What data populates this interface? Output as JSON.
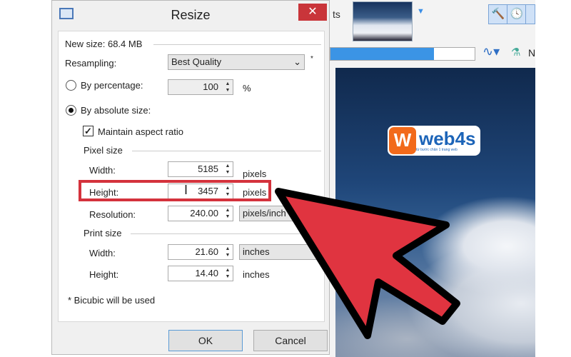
{
  "background_app": {
    "tab_partial": "ts",
    "progress_percent": 72,
    "toolbar_partial_text": "N",
    "icons": [
      "hammer-icon",
      "clock-icon",
      "path-icon",
      "flask-icon"
    ]
  },
  "logo": {
    "text": "web4s",
    "tagline": "từ bước chân 1 trang web",
    "letter": "W"
  },
  "dialog": {
    "title": "Resize",
    "close": "✕",
    "new_size": "New size: 68.4 MB",
    "resampling_label": "Resampling:",
    "resampling_value": "Best Quality",
    "resampling_note": "*",
    "by_percentage": "By percentage:",
    "percentage_value": "100",
    "percent_unit": "%",
    "by_absolute": "By absolute size:",
    "maintain_aspect": "Maintain aspect ratio",
    "pixel_size": "Pixel size",
    "px_width_label": "Width:",
    "px_width_value": "5185",
    "px_width_unit": "pixels",
    "px_height_label": "Height:",
    "px_height_value": "3457",
    "px_height_unit": "pixels",
    "resolution_label": "Resolution:",
    "resolution_value": "240.00",
    "resolution_unit": "pixels/inch",
    "print_size": "Print size",
    "pr_width_label": "Width:",
    "pr_width_value": "21.60",
    "pr_width_unit": "inches",
    "pr_height_label": "Height:",
    "pr_height_value": "14.40",
    "pr_height_unit": "inches",
    "footnote": "* Bicubic will be used",
    "ok": "OK",
    "cancel": "Cancel"
  },
  "colors": {
    "highlight": "#d4323c",
    "arrow": "#e03440",
    "close": "#c9353a",
    "progress": "#3b94e5"
  }
}
